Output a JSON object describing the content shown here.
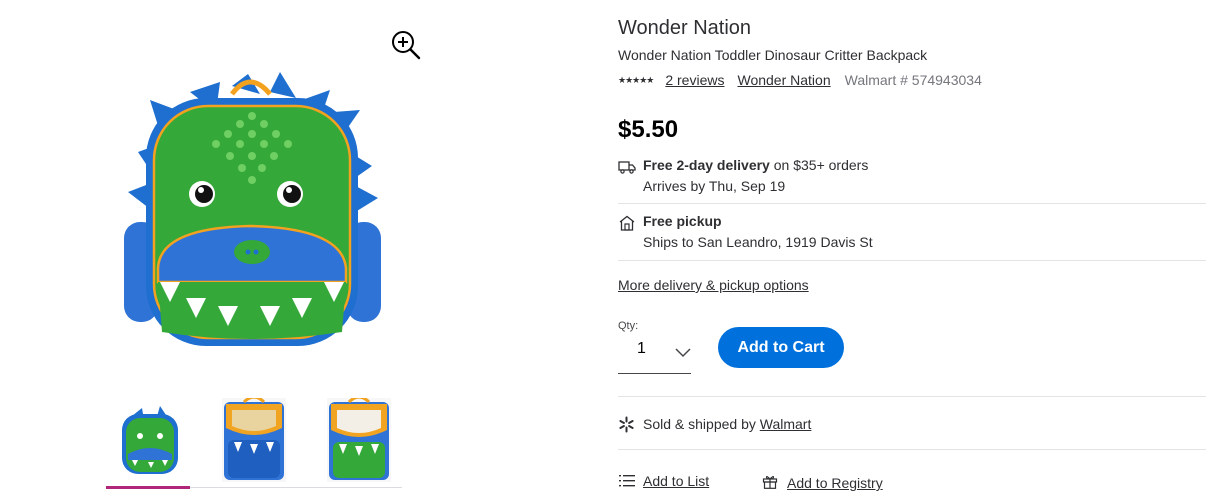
{
  "gallery": {
    "zoom_icon": "zoom-in-icon",
    "main_image_alt": "",
    "selected_thumb": 1,
    "colors": {
      "selected_underline": "#b0277a"
    }
  },
  "product": {
    "brand_title": "Wonder Nation",
    "title": "Wonder Nation Toddler Dinosaur Critter Backpack",
    "stars": "★★★★★",
    "reviews_link": "2 reviews",
    "brand_link": "Wonder Nation",
    "item_number": "Walmart # 574943034",
    "price": "$5.50"
  },
  "fulfillment": {
    "delivery": {
      "icon": "truck-icon",
      "title": "Free 2-day delivery",
      "suffix": " on $35+ orders",
      "detail": "Arrives by Thu, Sep 19"
    },
    "pickup": {
      "icon": "store-icon",
      "title": "Free pickup",
      "detail": "Ships to San Leandro, 1919 Davis St"
    },
    "more_options_link": "More delivery & pickup options"
  },
  "purchase": {
    "qty_label": "Qty:",
    "qty_value": "1",
    "add_to_cart": "Add to Cart",
    "colors": {
      "button": "#0071dc"
    }
  },
  "seller": {
    "icon": "walmart-spark-icon",
    "prefix": "Sold & shipped by ",
    "name": "Walmart"
  },
  "actions": {
    "add_to_list": "Add to List",
    "add_to_registry": "Add to Registry"
  }
}
